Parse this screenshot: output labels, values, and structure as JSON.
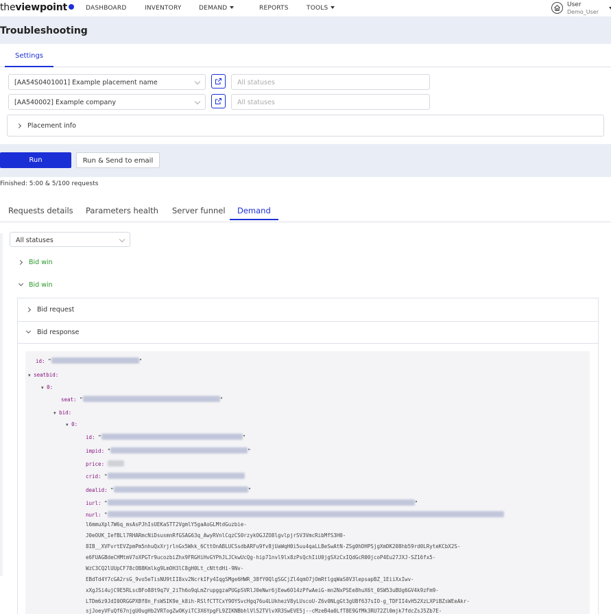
{
  "nav": {
    "logo_prefix": "the",
    "logo_bold": "viewpoint",
    "items": [
      "DASHBOARD",
      "INVENTORY",
      "DEMAND",
      "REPORTS",
      "TOOLS"
    ],
    "user_label": "User",
    "user_name": "Demo_User"
  },
  "page": {
    "title": "Troubleshooting"
  },
  "settings_tab": "Settings",
  "filters": {
    "placement": "[AA54S0401001] Example placement name",
    "company": "[AA540002] Example company",
    "status_placeholder_1": "All statuses",
    "status_placeholder_2": "All statuses",
    "placement_info": "Placement info"
  },
  "actions": {
    "run": "Run",
    "run_send": "Run & Send to email"
  },
  "status_text": "Finished: 5:00 & 5/100 requests",
  "tabs": [
    "Requests details",
    "Parameters health",
    "Server funnel",
    "Demand"
  ],
  "demand": {
    "filter": "All statuses",
    "bid_win_1": "Bid win",
    "bid_win_2": "Bid win",
    "bid_request": "Bid request",
    "bid_response": "Bid response"
  },
  "json_view": {
    "id_key": "id:",
    "seatbid_key": "seatbid:",
    "index_0": "0:",
    "seat_key": "seat:",
    "bid_key": "bid:",
    "bid_index": "0:",
    "fields": [
      "id:",
      "impid:",
      "price:",
      "crid:",
      "dealid:",
      "iurl:",
      "nurl:"
    ],
    "nurl_lines": [
      "l6mmuXpl7W6q_msAsPJhIsUEKaSTT2VgmlY5gaAoGLMtdGuzbie-",
      "J0eOUK_IefBLl7RHARmcNiDsusmnRfGSAG63q_AwyRVnlCqzCS0rzykOGJZO8lgvlpjrSV3VmcRibMfS3H0-",
      "8IB__XVFvrtEVZpmPm5nhuQxXrjrlnGx5Wkk_6CttOnABLUCSsdbARFu9fv8jUaWqH0i5uu4qaLLBeSwAtN-ZSg0hDHPSjgXmDK208hb59rd0LRyteKCbX2S-",
      "e6FUAGBdeCHMtmV7oXPGTr9ucozbiZhx9FRGHiHvGYPhJLJCkwUcQg-hip71nvl9lx8zPsQchIiU0jgSXzCxIQdGcR00jcoP4Eu27JXJ-SZ16fx5-",
      "WzC3CQ2lUUpCF78cOB8Kmlkg9LmOH3lC8gH0Lt_cNttdHi-9Nv-",
      "EBdTd4Y7cGA2rsG_9vo5eTisNU9tII8xv2NcrkIFy4IqgSMge6HWR_38fY0QlgSGCjZl4qmO7jOmRtlgqWaS0V3lepsapBZ_1EiiXxIwv-",
      "xXgJSi4ujC9E5RLscBFo88t9q7V_2iTh6o9qLmZrupggzaPUGpSVRlJ0eNwr6jEew6O14zPfwAeiG-mn2NxPSEe8huX6t_0SW53uBUg6GV4k9zFm9-",
      "LTDm6z9JdI0ORGGPXBf8n_FsWSIK9e_k8ih-RSlfCTTCxY9OYSvcHgq76u4LUkhezV8yLUscoU-Z6v0NLgGt3gUBf637sIO-g_TDFII4vH52XzLXPiBZsWEeAkr-",
      "sjJoeyVFuQf67njgU0ugHb2VRTogZwOKyiTC3X6YpgFL9ZIKNBbhlVl52TVlvXR3SwEVE5j--cMzeB4a0LfT8E9GfMk3RU72Zl0mjk7fdcZsJ5Zb7E-"
    ]
  },
  "colors": {
    "accent": "#1b2fd6",
    "band": "#e9edf5",
    "success": "#2a9a2a"
  }
}
